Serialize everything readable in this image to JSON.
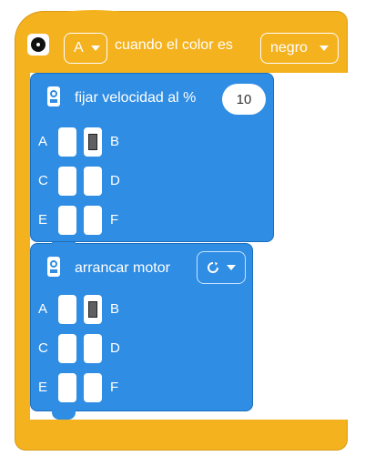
{
  "event": {
    "sensor_icon": "color-sensor-icon",
    "port_value": "A",
    "label": "cuando el color es",
    "color_value": "negro",
    "accent_color": "#f4b21e"
  },
  "speed_block": {
    "icon": "motor-icon",
    "label": "fijar velocidad al %",
    "value": "10",
    "ports": {
      "a": "A",
      "b": "B",
      "c": "C",
      "d": "D",
      "e": "E",
      "f": "F"
    },
    "active_port": "B",
    "accent_color": "#2f8de4"
  },
  "start_block": {
    "icon": "motor-icon",
    "label": "arrancar motor",
    "direction_icon": "rotate-clockwise-icon",
    "ports": {
      "a": "A",
      "b": "B",
      "c": "C",
      "d": "D",
      "e": "E",
      "f": "F"
    },
    "active_port": "B",
    "accent_color": "#2f8de4"
  }
}
